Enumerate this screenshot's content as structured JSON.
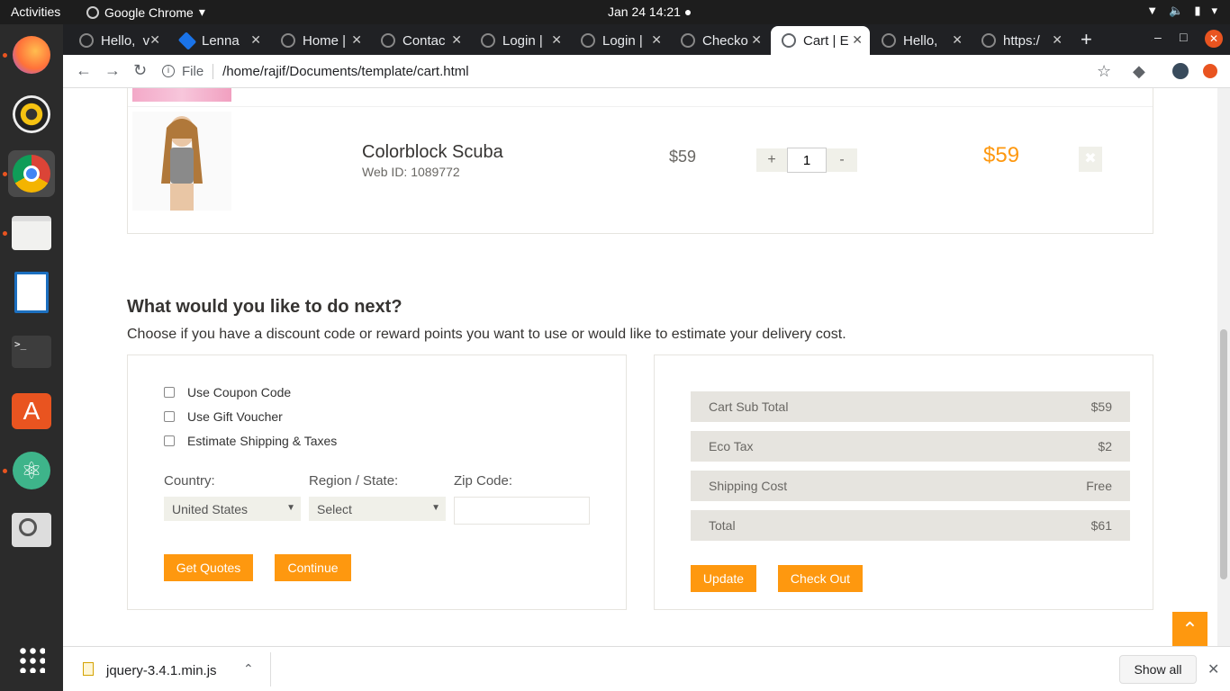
{
  "system": {
    "activities": "Activities",
    "app_name": "Google Chrome",
    "clock": "Jan 24  14:21 ●"
  },
  "tabs": [
    {
      "label": "Hello,  v"
    },
    {
      "label": "Lenna"
    },
    {
      "label": "Home |"
    },
    {
      "label": "Contac"
    },
    {
      "label": "Login |"
    },
    {
      "label": "Login |"
    },
    {
      "label": "Checko"
    },
    {
      "label": "Cart | E"
    },
    {
      "label": "Hello,   "
    },
    {
      "label": "https:/"
    }
  ],
  "address": {
    "scheme": "File",
    "url": "/home/rajif/Documents/template/cart.html"
  },
  "cart": {
    "item": {
      "name": "Colorblock Scuba",
      "web_id": "Web ID: 1089772",
      "price": "$59",
      "qty_plus": "+",
      "qty": "1",
      "qty_minus": "-",
      "total": "$59",
      "delete": "✖"
    }
  },
  "next": {
    "title": "What would you like to do next?",
    "desc": "Choose if you have a discount code or reward points you want to use or would like to estimate your delivery cost.",
    "options": [
      "Use Coupon Code",
      "Use Gift Voucher",
      "Estimate Shipping & Taxes"
    ],
    "country_label": "Country:",
    "country_value": "United States",
    "region_label": "Region / State:",
    "region_value": "Select",
    "zip_label": "Zip Code:",
    "get_quotes": "Get Quotes",
    "continue": "Continue"
  },
  "summary": {
    "rows": [
      {
        "k": "Cart Sub Total",
        "v": "$59"
      },
      {
        "k": "Eco Tax",
        "v": "$2"
      },
      {
        "k": "Shipping Cost",
        "v": "Free"
      },
      {
        "k": "Total",
        "v": "$61"
      }
    ],
    "update": "Update",
    "checkout": "Check Out"
  },
  "downloads": {
    "file": "jquery-3.4.1.min.js",
    "show_all": "Show all"
  },
  "colors": {
    "accent": "#fe980f",
    "ubuntu": "#e95420"
  }
}
